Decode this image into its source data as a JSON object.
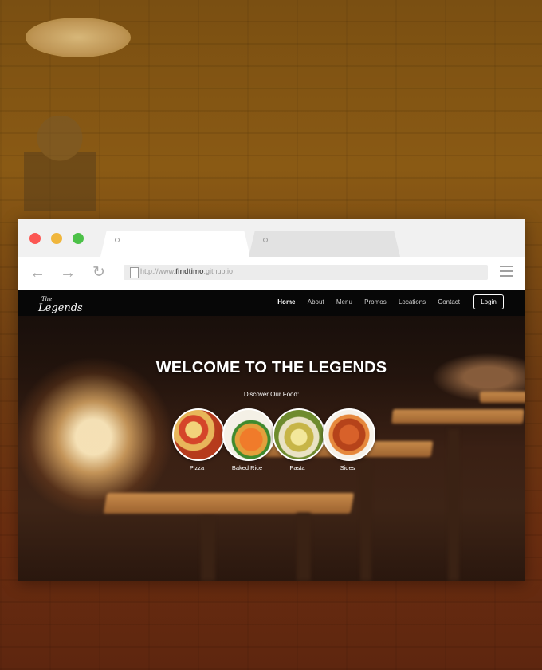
{
  "browser": {
    "url_prefix": "http://www.",
    "url_domain": "findtimo",
    "url_suffix": ".github.io"
  },
  "site": {
    "logo_small": "The",
    "logo_main": "Legends",
    "nav": [
      "Home",
      "About",
      "Menu",
      "Promos",
      "Locations",
      "Contact"
    ],
    "active_nav": "Home",
    "login_label": "Login",
    "hero_title": "WELCOME TO THE LEGENDS",
    "hero_subtitle": "Discover Our Food:",
    "foods": [
      {
        "label": "Pizza"
      },
      {
        "label": "Baked Rice"
      },
      {
        "label": "Pasta"
      },
      {
        "label": "Sides"
      }
    ]
  },
  "colors": {
    "close": "#fc5753",
    "minimize": "#f0b63c",
    "maximize": "#4cc148",
    "site_nav_bg": "#070707"
  },
  "icons": [
    "back-arrow-icon",
    "forward-arrow-icon",
    "reload-icon",
    "document-icon",
    "hamburger-menu-icon"
  ]
}
